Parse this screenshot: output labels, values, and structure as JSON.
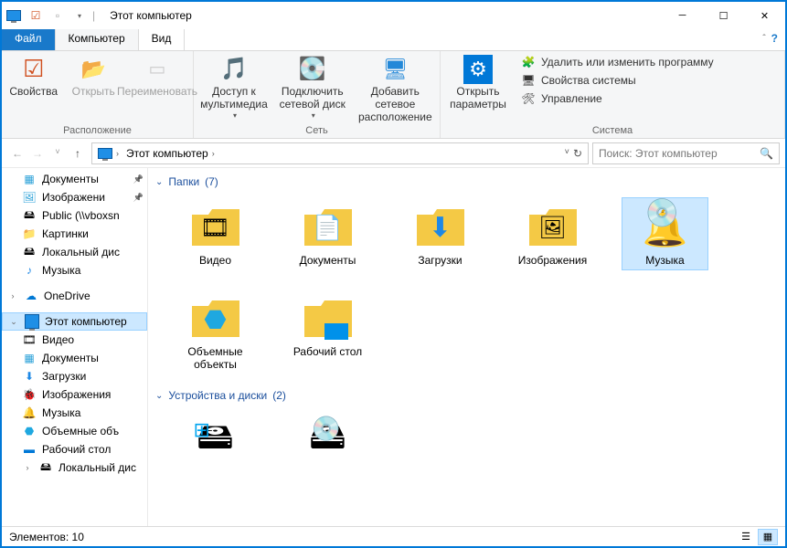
{
  "title": "Этот компьютер",
  "tabs": {
    "file": "Файл",
    "computer": "Компьютер",
    "view": "Вид"
  },
  "ribbon": {
    "props": "Свойства",
    "open": "Открыть",
    "rename": "Переименовать",
    "group1": "Расположение",
    "media": "Доступ к мультимедиа",
    "netdrive": "Подключить сетевой диск",
    "addnet": "Добавить сетевое расположение",
    "group2": "Сеть",
    "settings": "Открыть параметры",
    "uninstall": "Удалить или изменить программу",
    "sysprops": "Свойства системы",
    "manage": "Управление",
    "group3": "Система"
  },
  "breadcrumb": "Этот компьютер",
  "search_ph": "Поиск: Этот компьютер",
  "nav": {
    "docs": "Документы",
    "imgs": "Изображени",
    "public": "Public (\\\\vboxsn",
    "pics": "Картинки",
    "localdisk": "Локальный дис",
    "music": "Музыка",
    "onedrive": "OneDrive",
    "thispc": "Этот компьютер",
    "video": "Видео",
    "docs2": "Документы",
    "downloads": "Загрузки",
    "imgs2": "Изображения",
    "music2": "Музыка",
    "objects": "Объемные объ",
    "desktop": "Рабочий стол",
    "localdisk2": "Локальный дис"
  },
  "groups": {
    "folders": "Папки",
    "folders_count": "(7)",
    "devices": "Устройства и диски",
    "devices_count": "(2)"
  },
  "folders": {
    "video": "Видео",
    "docs": "Документы",
    "downloads": "Загрузки",
    "images": "Изображения",
    "music": "Музыка",
    "objects": "Объемные объекты",
    "desktop": "Рабочий стол"
  },
  "status": "Элементов: 10"
}
